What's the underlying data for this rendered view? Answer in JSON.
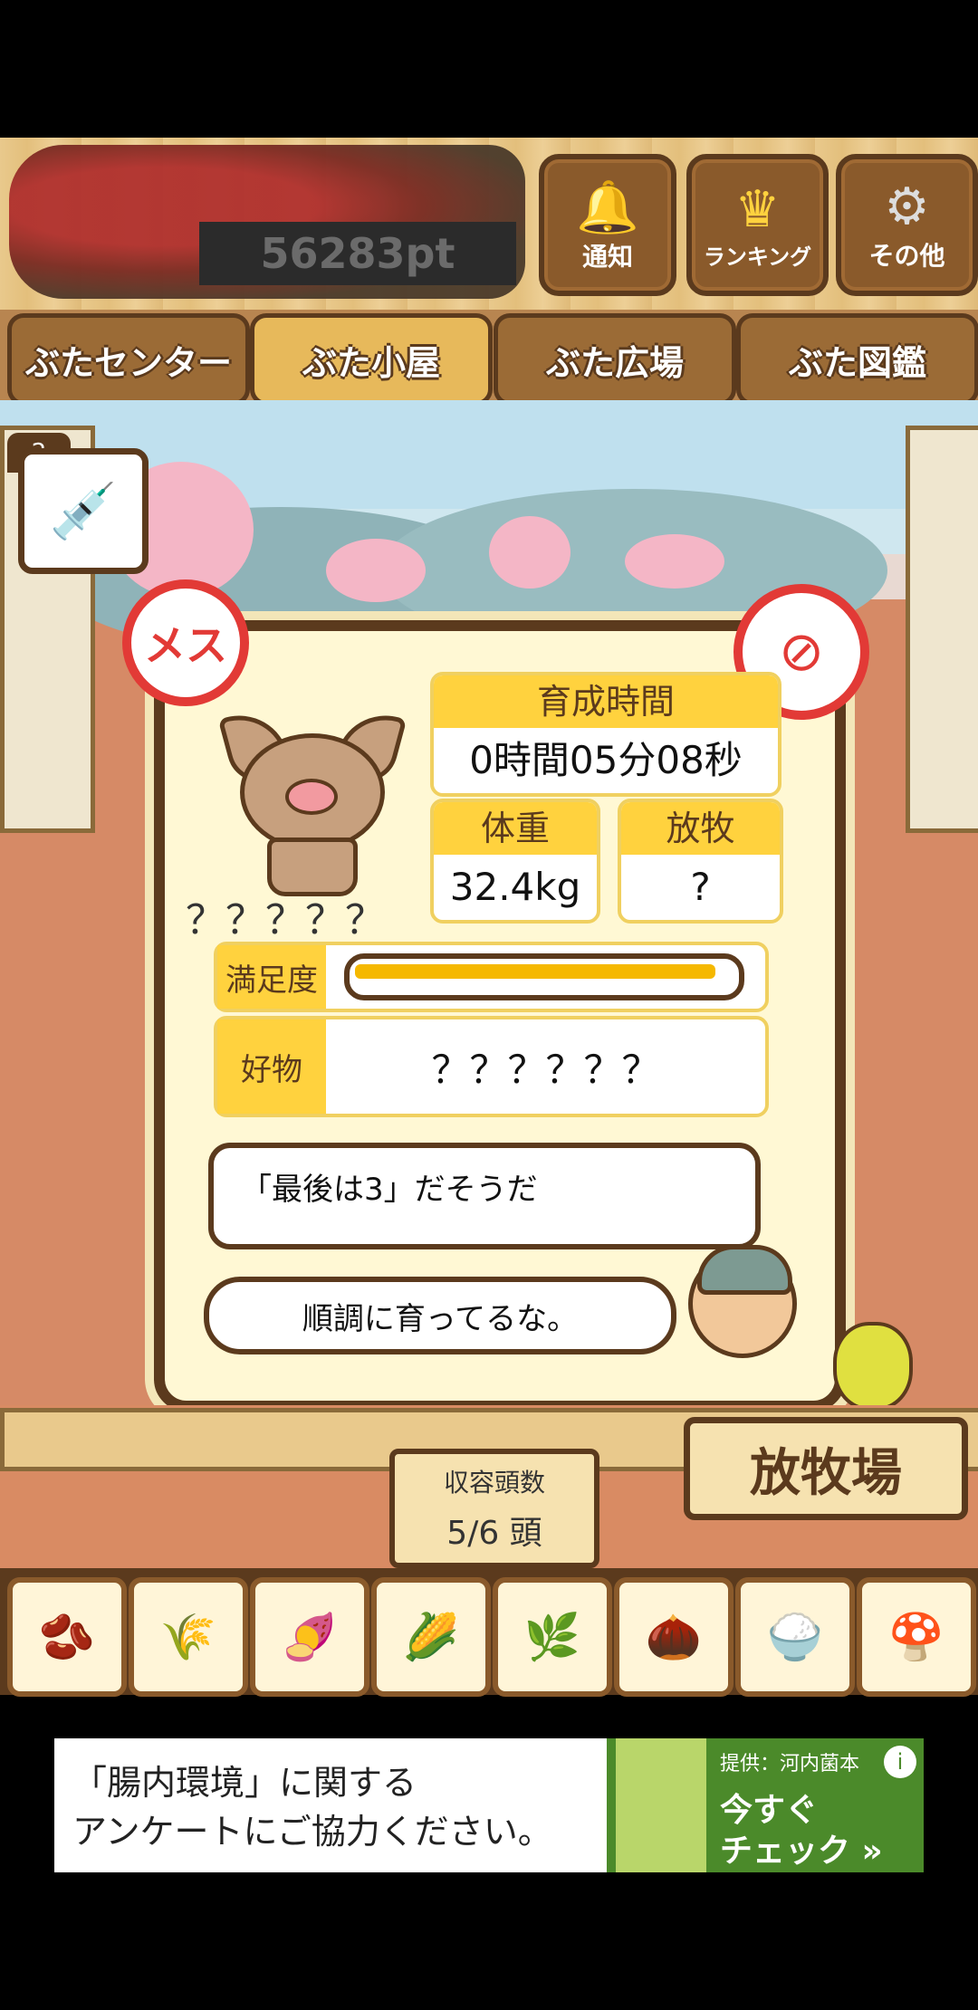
{
  "header": {
    "points_text": "56283pt",
    "buttons": [
      {
        "id": "notice",
        "label": "通知",
        "icon": "bell-icon"
      },
      {
        "id": "ranking",
        "label": "ランキング",
        "icon": "crown-icon"
      },
      {
        "id": "other",
        "label": "その他",
        "icon": "gear-icon"
      }
    ]
  },
  "tabs": [
    {
      "label": "ぶたセンター"
    },
    {
      "label": "ぶた小屋",
      "active": true
    },
    {
      "label": "ぶた広場"
    },
    {
      "label": "ぶた図鑑"
    }
  ],
  "item": {
    "count": "2",
    "icon": "syringe-icon"
  },
  "panel": {
    "gender_badge": "メス",
    "pig_name": "？？？？？",
    "growth_time": {
      "label": "育成時間",
      "value": "0時間05分08秒"
    },
    "weight": {
      "label": "体重",
      "value": "32.4kg"
    },
    "grazing": {
      "label": "放牧",
      "value": "?"
    },
    "satisfaction": {
      "label": "満足度",
      "level": 0.98
    },
    "favorite": {
      "label": "好物",
      "value": "？？？？？？"
    },
    "hint_text": "「最後は3」だそうだ",
    "farmer_text": "順調に育ってるな。"
  },
  "capacity": {
    "label": "収容頭数",
    "value": "5/6 頭"
  },
  "pasture_sign": "放牧場",
  "foods": [
    {
      "name": "beans-food-icon",
      "glyph": "🫘"
    },
    {
      "name": "grain-food-icon",
      "glyph": "🌾"
    },
    {
      "name": "sweet-potato-food-icon",
      "glyph": "🍠"
    },
    {
      "name": "corn-food-icon",
      "glyph": "🌽"
    },
    {
      "name": "soybean-food-icon",
      "glyph": "🌿"
    },
    {
      "name": "acorn-food-icon",
      "glyph": "🌰"
    },
    {
      "name": "rice-plate-food-icon",
      "glyph": "🍚"
    },
    {
      "name": "truffle-food-icon",
      "glyph": "🍄"
    }
  ],
  "ad": {
    "line1": "「腸内環境」に関する",
    "line2": "アンケートにご協力ください。",
    "sponsor": "提供：河内菌本",
    "cta_line1": "今すぐ",
    "cta_line2": "チェック »",
    "info_icon": "info-icon"
  }
}
